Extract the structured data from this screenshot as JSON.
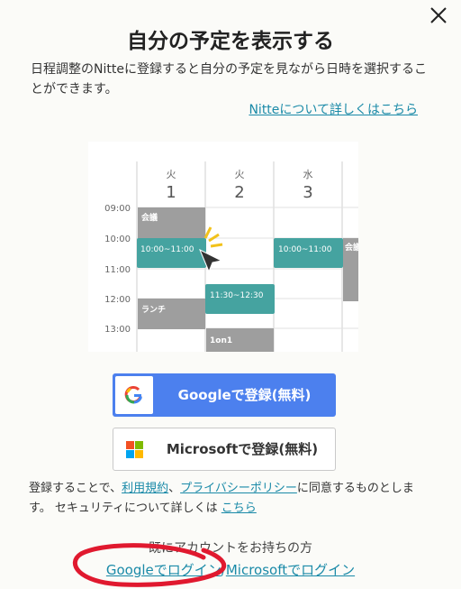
{
  "dialog": {
    "title": "自分の予定を表示する",
    "description": "日程調整のNitteに登録すると自分の予定を見ながら日時を選択することができます。",
    "detail_link": "Nitteについて詳しくはこちら"
  },
  "calendar": {
    "days": [
      {
        "weekday": "火",
        "date": "1"
      },
      {
        "weekday": "火",
        "date": "2"
      },
      {
        "weekday": "水",
        "date": "3"
      }
    ],
    "times": [
      "09:00",
      "10:00",
      "11:00",
      "12:00",
      "13:00"
    ],
    "events": {
      "meeting1": "会議",
      "slot1": "10:00~11:00",
      "slot2": "10:00~11:00",
      "meeting2": "会議",
      "lunch": "ランチ",
      "slot3": "11:30~12:30",
      "one_on_one": "1on1"
    }
  },
  "buttons": {
    "google_label": "Googleで登録(無料)",
    "microsoft_label": "Microsoftで登録(無料)"
  },
  "terms": {
    "prefix": "登録することで、",
    "tos": "利用規約",
    "sep": "、",
    "privacy": "プライバシーポリシー",
    "suffix": "に同意するものとします。 セキュリティについて詳しくは ",
    "security_link": "こちら"
  },
  "login": {
    "already": "既にアカウントをお持ちの方",
    "google": "Googleでログイン",
    "sep": "/",
    "microsoft": "Microsoftでログイン"
  },
  "colors": {
    "accent": "#1a8aa8",
    "google_button": "#4c80ee",
    "event_teal": "#45a3a0",
    "event_gray": "#9e9e9e",
    "annotation_red": "#e0192f"
  }
}
